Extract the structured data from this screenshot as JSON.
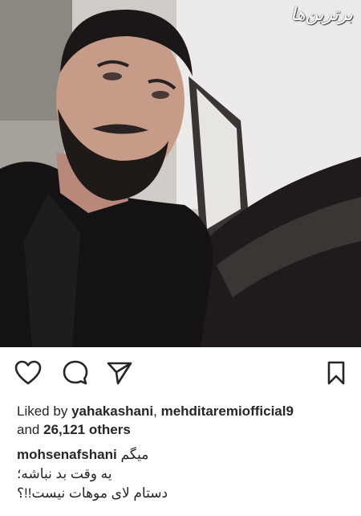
{
  "watermark": "برترین‌ها",
  "icons": {
    "like": "heart-icon",
    "comment": "comment-bubble-icon",
    "share": "paper-plane-icon",
    "save": "bookmark-icon"
  },
  "likes": {
    "prefix": "Liked by",
    "user1": "yahakashani",
    "separator": ",",
    "user2": "mehditaremiofficial9",
    "and": "and",
    "count": "26,121 others"
  },
  "caption": {
    "username": "mohsenafshani",
    "line1": "میگم",
    "line2": "یه وقت بد نباشه؛",
    "line3": "دستام لای موهات نیست!!؟"
  },
  "colors": {
    "text": "#262626",
    "background": "#ffffff"
  }
}
